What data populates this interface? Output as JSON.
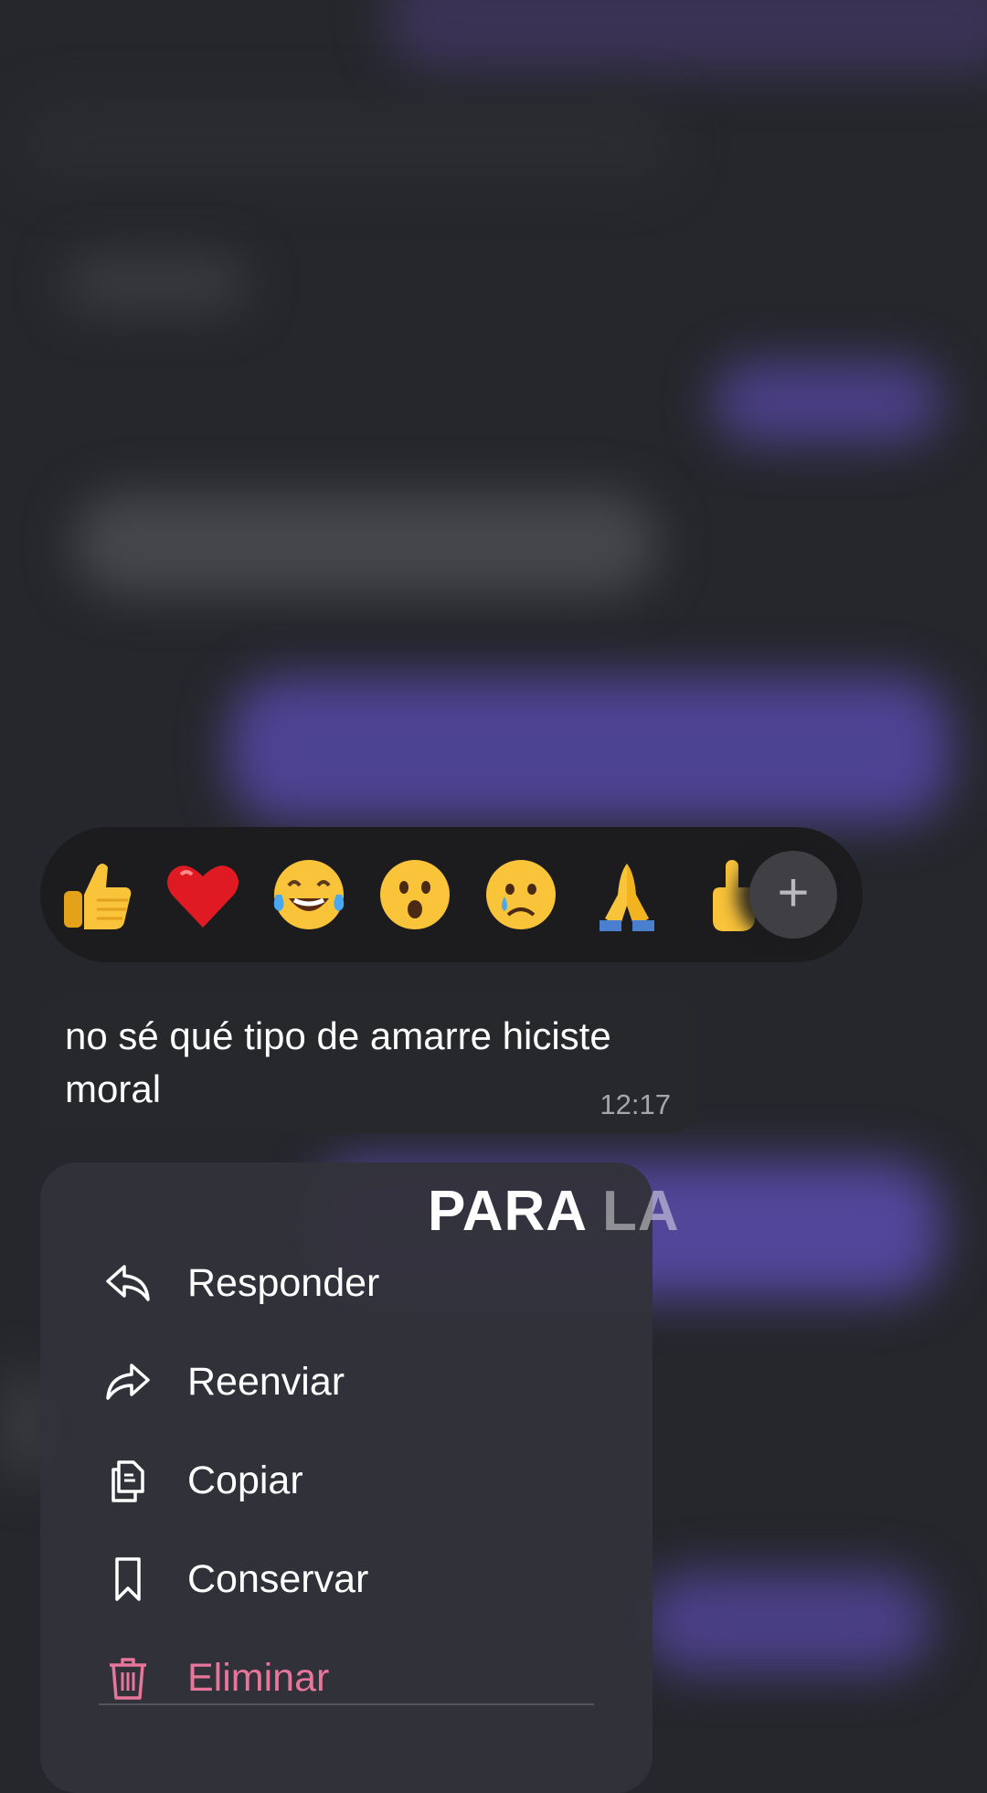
{
  "reactions": {
    "items": [
      {
        "name": "thumbs-up"
      },
      {
        "name": "red-heart"
      },
      {
        "name": "tears-of-joy"
      },
      {
        "name": "surprised-face"
      },
      {
        "name": "crying-face"
      },
      {
        "name": "folded-hands"
      },
      {
        "name": "index-pointing-up"
      }
    ],
    "more_label": "+"
  },
  "message": {
    "text": "no sé qué tipo de amarre hiciste moral",
    "time": "12:17"
  },
  "caption": {
    "word1": "PARA",
    "word2": "LA"
  },
  "menu": {
    "reply": "Responder",
    "forward": "Reenviar",
    "copy": "Copiar",
    "save": "Conservar",
    "delete": "Eliminar"
  },
  "colors": {
    "background": "#25272c",
    "menu_bg": "#32323a",
    "danger": "#e8769a",
    "accent_bubble": "#4d4393"
  }
}
